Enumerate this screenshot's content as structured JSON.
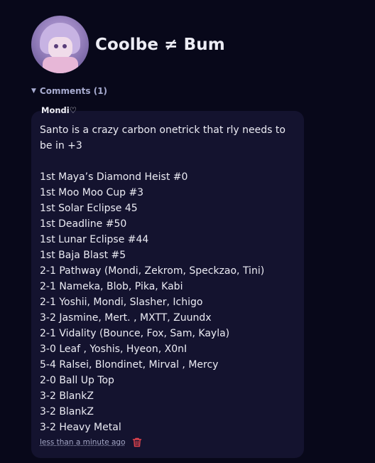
{
  "profile": {
    "name": "Coolbe ≠ Bum"
  },
  "comments": {
    "toggle_label": "Comments (1)",
    "items": [
      {
        "author": "Mondi♡",
        "text": "Santo is a crazy carbon onetrick that rly needs to be in +3\n\n1st Maya’s Diamond Heist #0\n1st Moo Moo Cup #3\n1st Solar Eclipse 45\n1st Deadline #50\n1st Lunar Eclipse #44\n1st Baja Blast #5\n2-1 Pathway (Mondi, Zekrom, Speckzao, Tini)\n2-1 Nameka, Blob, Pika, Kabi\n2-1 Yoshii, Mondi, Slasher, Ichigo\n3-2 Jasmine, Mert. , MXTT, Zuundx\n2-1 Vidality (Bounce, Fox, Sam, Kayla)\n3-0 Leaf , Yoshis, Hyeon, X0nI\n5-4 Ralsei, Blondinet, Mirval , Mercy\n2-0 Ball Up Top\n3-2 BlankZ\n3-2 BlankZ\n3-2 Heavy Metal",
        "timestamp": "less than a minute ago"
      }
    ]
  },
  "icons": {
    "delete": "trash-icon",
    "expand": "caret-down-icon"
  },
  "colors": {
    "background": "#08081a",
    "bubble": "#14132f",
    "delete": "#e0434d"
  }
}
